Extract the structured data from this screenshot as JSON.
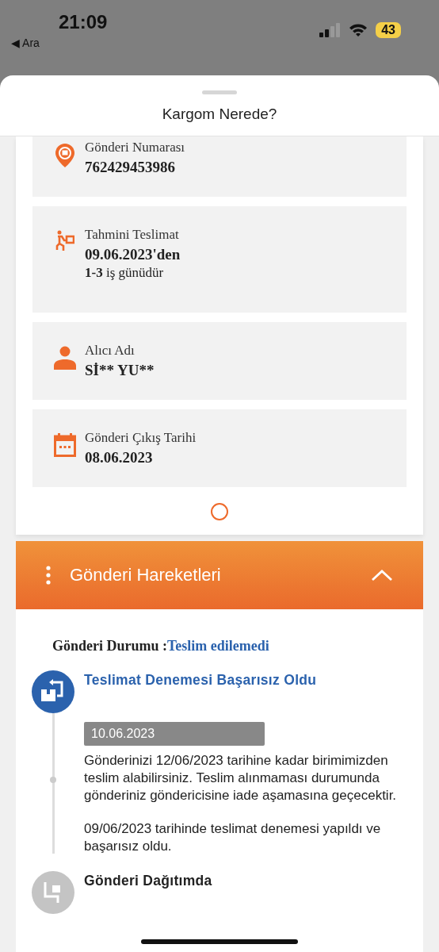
{
  "status_bar": {
    "time": "21:09",
    "back_label": "◀ Ara",
    "battery": "43"
  },
  "sheet": {
    "title": "Kargom Nerede?"
  },
  "info_boxes": [
    {
      "kind": "pin",
      "label": "Gönderi Numarası",
      "value": "762429453986"
    },
    {
      "kind": "courier",
      "label": "Tahmini Teslimat",
      "value": "09.06.2023'den",
      "note": "**1-3** iş günüdür"
    },
    {
      "kind": "person",
      "label": "Alıcı Adı",
      "value": "Sİ** YU**"
    },
    {
      "kind": "calendar",
      "label": "Gönderi Çıkış Tarihi",
      "value": "08.06.2023"
    }
  ],
  "movements": {
    "title": "Gönderi Hareketleri",
    "expanded": true,
    "status_label": "Gönderi Durumu :",
    "status_value": "Teslim edilemedi",
    "events": [
      {
        "kind": "active",
        "title": "Teslimat Denemesi Başarısız Oldu",
        "date": "10.06.2023",
        "paragraphs": [
          "Gönderinizi 12/06/2023 tarihine kadar birimimizden teslim alabilirsiniz. Teslim alınmaması durumunda gönderiniz göndericisine iade aşamasına geçecektir.",
          "09/06/2023 tarihinde teslimat denemesi yapıldı ve başarısız oldu."
        ]
      },
      {
        "kind": "pending",
        "title": "Gönderi Dağıtımda"
      }
    ]
  }
}
